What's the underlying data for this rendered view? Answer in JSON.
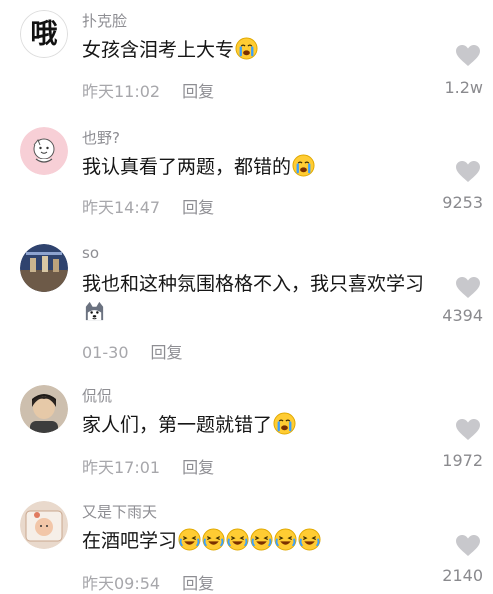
{
  "comments": [
    {
      "username": "扑克脸",
      "text": "女孩含泪考上大专",
      "emojis": [
        "crying-face"
      ],
      "time": "昨天11:02",
      "reply": "回复",
      "likes": "1.2w",
      "avatar": {
        "type": "text-logo",
        "glyph": "哦",
        "bg": "#ffffff",
        "fg": "#111111"
      }
    },
    {
      "username": "也野?",
      "text": "我认真看了两题，都错的",
      "emojis": [
        "crying-face"
      ],
      "time": "昨天14:47",
      "reply": "回复",
      "likes": "9253",
      "avatar": {
        "type": "cartoon",
        "bg": "#f7cfd6"
      }
    },
    {
      "username": "so",
      "text": "我也和这种氛围格格不入，我只喜欢学习",
      "emojis": [
        "husky-dog"
      ],
      "time": "01-30",
      "reply": "回复",
      "likes": "4394",
      "avatar": {
        "type": "photo",
        "bg": "#3b4f7a"
      }
    },
    {
      "username": "侃侃",
      "text": "家人们，第一题就错了",
      "emojis": [
        "crying-face"
      ],
      "time": "昨天17:01",
      "reply": "回复",
      "likes": "1972",
      "avatar": {
        "type": "photo-person",
        "bg": "#cdbfae"
      }
    },
    {
      "username": "又是下雨天",
      "text": "在酒吧学习",
      "emojis": [
        "laughing-face",
        "laughing-face",
        "laughing-face",
        "laughing-face",
        "laughing-face",
        "laughing-face"
      ],
      "time": "昨天09:54",
      "reply": "回复",
      "likes": "2140",
      "avatar": {
        "type": "photo-baby",
        "bg": "#e9d9cc"
      }
    }
  ],
  "colors": {
    "username": "#8e8e93",
    "meta": "#a7a7ab",
    "like_icon": "#c8c8cc",
    "text": "#161616"
  }
}
